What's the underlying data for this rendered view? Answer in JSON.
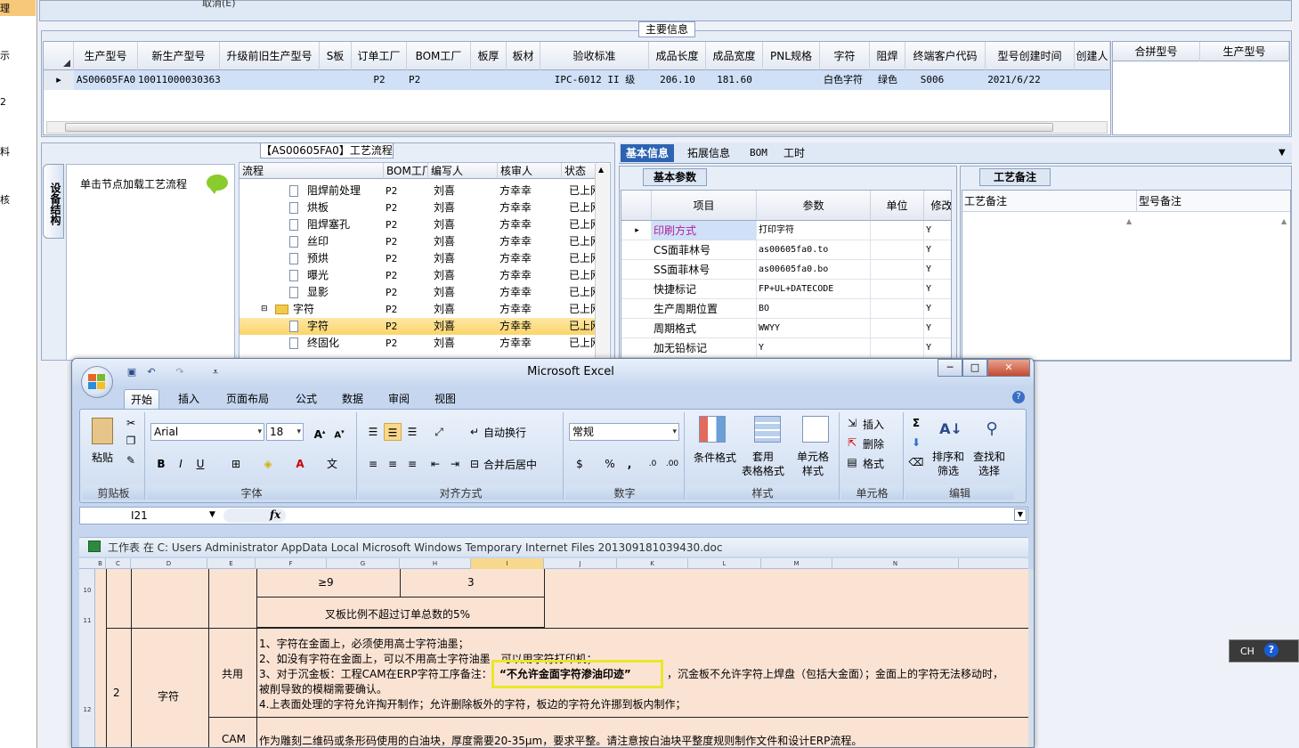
{
  "left_strip": {
    "items": [
      "理",
      "示",
      "2",
      "料",
      "核"
    ]
  },
  "top_strip": {
    "text": "取消(E)"
  },
  "main_info": {
    "title": "主要信息",
    "columns": [
      "生产型号",
      "新生产型号",
      "升级前旧生产型号",
      "S板",
      "订单工厂",
      "BOM工厂",
      "板厚",
      "板材",
      "验收标准",
      "成品长度",
      "成品宽度",
      "PNL规格",
      "字符",
      "阻焊",
      "终端客户代码",
      "型号创建时间",
      "创建人"
    ],
    "row": [
      "AS00605FA0",
      "10011000030363",
      "",
      "",
      "P2",
      "P2",
      "",
      "",
      "IPC-6012 II 级",
      "206.10",
      "181.60",
      "",
      "白色字符",
      "绿色",
      "S006",
      "2021/6/22",
      ""
    ],
    "row_marker": "▸",
    "right_columns": [
      "合拼型号",
      "生产型号"
    ]
  },
  "process": {
    "title": "【AS00605FA0】工艺流程",
    "side_tab": "设备结构",
    "node_hint": "单击节点加载工艺流程",
    "columns": [
      "流程",
      "BOM工厂",
      "编写人",
      "核审人",
      "状态"
    ],
    "rows": [
      {
        "name": "阻焊前处理",
        "bom": "P2",
        "writer": "刘喜",
        "checker": "方幸幸",
        "status": "已上网",
        "type": "doc",
        "selected": false
      },
      {
        "name": "烘板",
        "bom": "P2",
        "writer": "刘喜",
        "checker": "方幸幸",
        "status": "已上网",
        "type": "doc",
        "selected": false
      },
      {
        "name": "阻焊塞孔",
        "bom": "P2",
        "writer": "刘喜",
        "checker": "方幸幸",
        "status": "已上网",
        "type": "doc",
        "selected": false
      },
      {
        "name": "丝印",
        "bom": "P2",
        "writer": "刘喜",
        "checker": "方幸幸",
        "status": "已上网",
        "type": "doc",
        "selected": false
      },
      {
        "name": "预烘",
        "bom": "P2",
        "writer": "刘喜",
        "checker": "方幸幸",
        "status": "已上网",
        "type": "doc",
        "selected": false
      },
      {
        "name": "曝光",
        "bom": "P2",
        "writer": "刘喜",
        "checker": "方幸幸",
        "status": "已上网",
        "type": "doc",
        "selected": false
      },
      {
        "name": "显影",
        "bom": "P2",
        "writer": "刘喜",
        "checker": "方幸幸",
        "status": "已上网",
        "type": "doc",
        "selected": false
      },
      {
        "name": "字符",
        "bom": "P2",
        "writer": "刘喜",
        "checker": "方幸幸",
        "status": "已上网",
        "type": "folder",
        "selected": false
      },
      {
        "name": "字符",
        "bom": "P2",
        "writer": "刘喜",
        "checker": "方幸幸",
        "status": "已上网",
        "type": "doc",
        "selected": true
      },
      {
        "name": "终固化",
        "bom": "P2",
        "writer": "刘喜",
        "checker": "方幸幸",
        "status": "已上网",
        "type": "doc",
        "selected": false
      }
    ]
  },
  "right_tabs": [
    "基本信息",
    "拓展信息",
    "BOM",
    "工时"
  ],
  "basic_params": {
    "tab": "基本参数",
    "columns": [
      "项目",
      "参数",
      "单位",
      "修改"
    ],
    "rows": [
      {
        "item": "印刷方式",
        "param": "打印字符",
        "unit": "",
        "mod": "Y"
      },
      {
        "item": "CS面菲林号",
        "param": "as00605fa0.to",
        "unit": "",
        "mod": "Y"
      },
      {
        "item": "SS面菲林号",
        "param": "as00605fa0.bo",
        "unit": "",
        "mod": "Y"
      },
      {
        "item": "快捷标记",
        "param": "FP+UL+DATECODE",
        "unit": "",
        "mod": "Y"
      },
      {
        "item": "生产周期位置",
        "param": "BO",
        "unit": "",
        "mod": "Y"
      },
      {
        "item": "周期格式",
        "param": "WWYY",
        "unit": "",
        "mod": "Y"
      },
      {
        "item": "加无铅标记",
        "param": "Y",
        "unit": "",
        "mod": "Y"
      }
    ]
  },
  "craft": {
    "tab": "工艺备注",
    "col1": "工艺备注",
    "col2": "型号备注"
  },
  "excel": {
    "title": "Microsoft Excel",
    "tabs": [
      "开始",
      "插入",
      "页面布局",
      "公式",
      "数据",
      "审阅",
      "视图"
    ],
    "font_name": "Arial",
    "font_size": "18",
    "number_format": "常规",
    "groups": [
      "剪贴板",
      "字体",
      "对齐方式",
      "数字",
      "样式",
      "单元格",
      "编辑"
    ],
    "labels": {
      "paste": "粘贴",
      "wrap": "自动换行",
      "merge": "合并后居中",
      "cond_format": "条件格式",
      "table_format": "套用\n表格格式",
      "cell_style": "单元格\n样式",
      "insert": "插入",
      "delete": "删除",
      "format": "格式",
      "sort": "排序和\n筛选",
      "find": "查找和\n选择"
    },
    "name_box": "I21",
    "fx": "fx",
    "sheet_path": "工作表 在 C: Users Administrator AppData Local Microsoft Windows Temporary Internet Files 201309181039430.doc",
    "col_headers": [
      "B",
      "C",
      "D",
      "E",
      "F",
      "G",
      "H",
      "I",
      "J",
      "K",
      "L",
      "M",
      "N"
    ],
    "row_headers": [
      "10",
      "11",
      "12"
    ],
    "cells": {
      "ge9": "≥9",
      "three": "3",
      "ratio": "叉板比例不超过订单总数的5%",
      "num2": "2",
      "char": "字符",
      "shared": "共用",
      "cam": "CAM",
      "line1": "1、字符在金面上，必须使用高士字符油墨；",
      "line2": "2、如没有字符在金面上，可以不用高士字符油墨，可以用字符打印机；",
      "line3a": "3、对于沉金板：工程CAM在ERP字符工序备注：",
      "line3b": "“不允许金面字符渗油印迹”",
      "line3c": "，沉金板不允许字符上焊盘（包括大金面）；金面上的字符无法移动时，",
      "line3d": "被削导致的模糊需要确认。",
      "line4": "4.上表面处理的字符允许掏开制作；允许删除板外的字符，板边的字符允许挪到板内制作；",
      "cam_text": "作为雕刻二维码或条形码使用的白油块，厚度需要20-35μm，要求平整。请注意按白油块平整度规则制作文件和设计ERP流程。"
    }
  },
  "ime": {
    "text": "CH",
    "help": "?"
  }
}
